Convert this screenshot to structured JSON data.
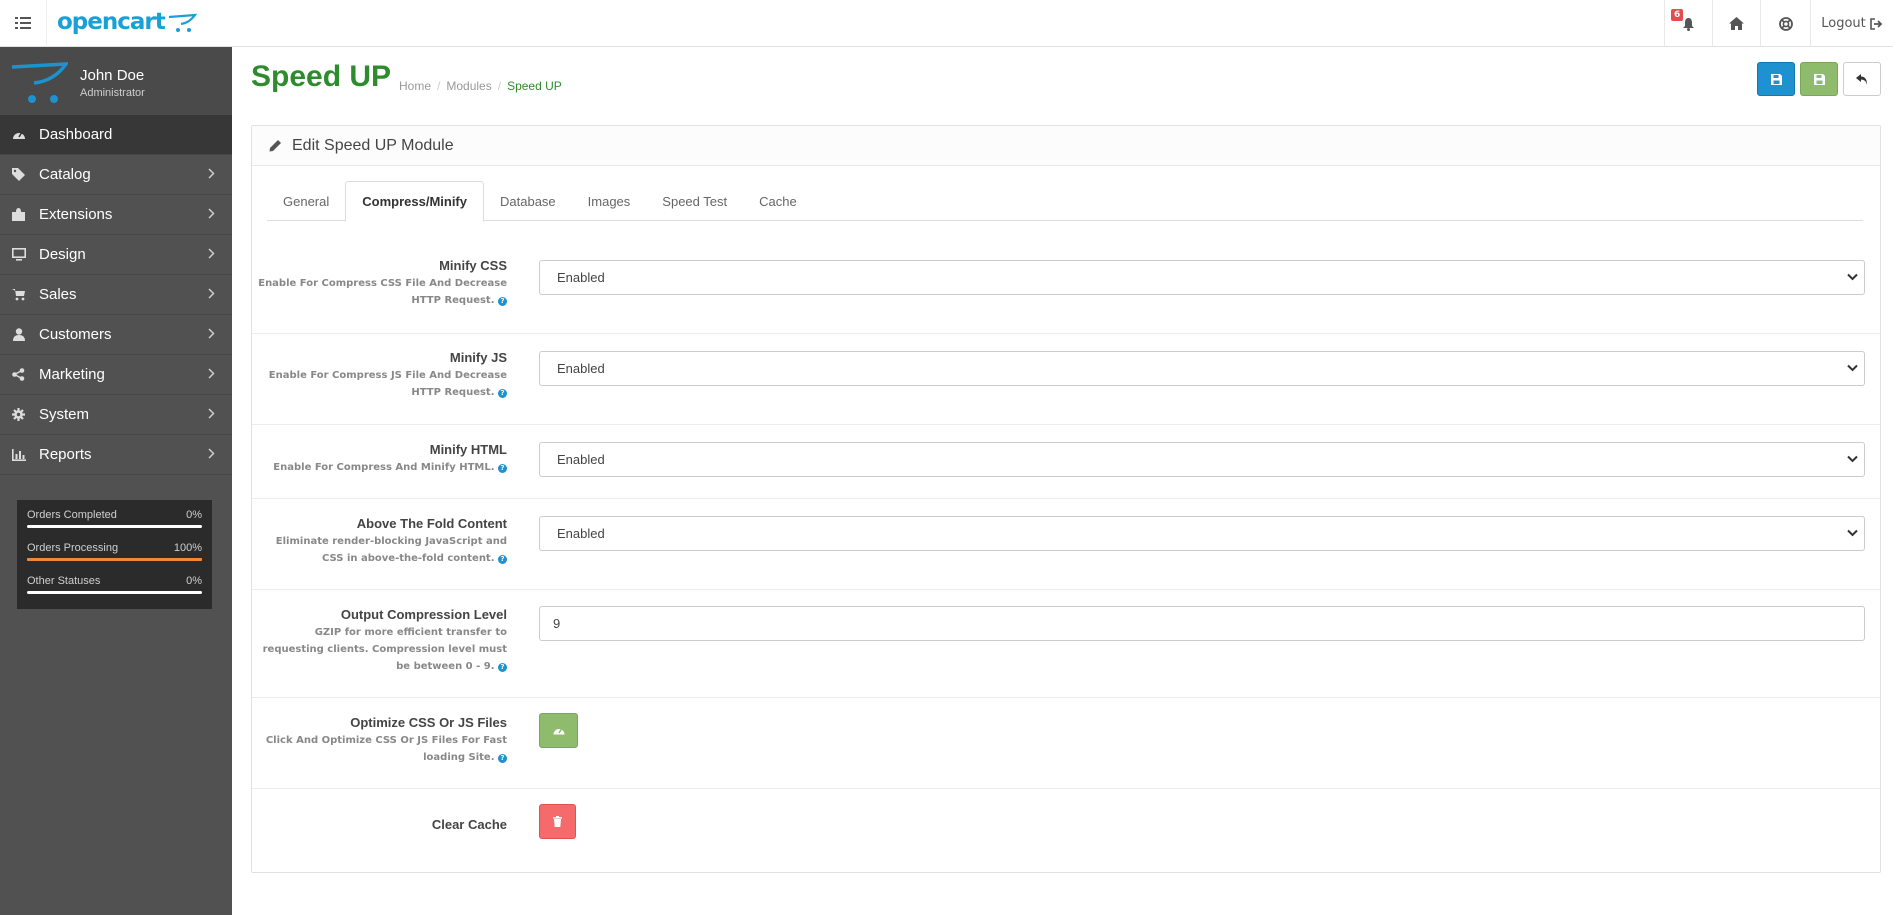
{
  "header": {
    "logo_text": "opencart",
    "notification_count": "6",
    "logout_label": "Logout"
  },
  "user": {
    "name": "John Doe",
    "role": "Administrator"
  },
  "sidebar": {
    "items": [
      {
        "label": "Dashboard",
        "icon": "dashboard-icon"
      },
      {
        "label": "Catalog",
        "icon": "tags-icon"
      },
      {
        "label": "Extensions",
        "icon": "puzzle-icon"
      },
      {
        "label": "Design",
        "icon": "monitor-icon"
      },
      {
        "label": "Sales",
        "icon": "cart-icon"
      },
      {
        "label": "Customers",
        "icon": "user-icon"
      },
      {
        "label": "Marketing",
        "icon": "share-icon"
      },
      {
        "label": "System",
        "icon": "gear-icon"
      },
      {
        "label": "Reports",
        "icon": "bar-chart-icon"
      }
    ],
    "stats": [
      {
        "label": "Orders Completed",
        "value": "0%",
        "fill": 0,
        "color": "#ffffff"
      },
      {
        "label": "Orders Processing",
        "value": "100%",
        "fill": 100,
        "color": "#f38733"
      },
      {
        "label": "Other Statuses",
        "value": "0%",
        "fill": 0,
        "color": "#ffffff"
      }
    ]
  },
  "page": {
    "title": "Speed UP",
    "breadcrumb": [
      "Home",
      "Modules",
      "Speed UP"
    ]
  },
  "panel": {
    "heading": "Edit Speed UP Module",
    "tabs": [
      "General",
      "Compress/Minify",
      "Database",
      "Images",
      "Speed Test",
      "Cache"
    ],
    "active_tab": "Compress/Minify"
  },
  "form": {
    "minify_css": {
      "label": "Minify CSS",
      "help": "Enable For Compress CSS File And Decrease HTTP Request.",
      "value": "Enabled"
    },
    "minify_js": {
      "label": "Minify JS",
      "help": "Enable For Compress JS File And Decrease HTTP Request.",
      "value": "Enabled"
    },
    "minify_html": {
      "label": "Minify HTML",
      "help": "Enable For Compress And Minify HTML.",
      "value": "Enabled"
    },
    "above_fold": {
      "label": "Above The Fold Content",
      "help": "Eliminate render-blocking JavaScript and CSS in above-the-fold content.",
      "value": "Enabled"
    },
    "compression_level": {
      "label": "Output Compression Level",
      "help": "GZIP for more efficient transfer to requesting clients. Compression level must be between 0 - 9.",
      "value": "9"
    },
    "optimize_files": {
      "label": "Optimize CSS Or JS Files",
      "help": "Click And Optimize CSS Or JS Files For Fast loading Site."
    },
    "clear_cache": {
      "label": "Clear Cache"
    }
  },
  "colors": {
    "primary": "#1e91cf",
    "success": "#8fbb6c",
    "danger": "#f56b6b",
    "title": "#2e8b2e"
  }
}
